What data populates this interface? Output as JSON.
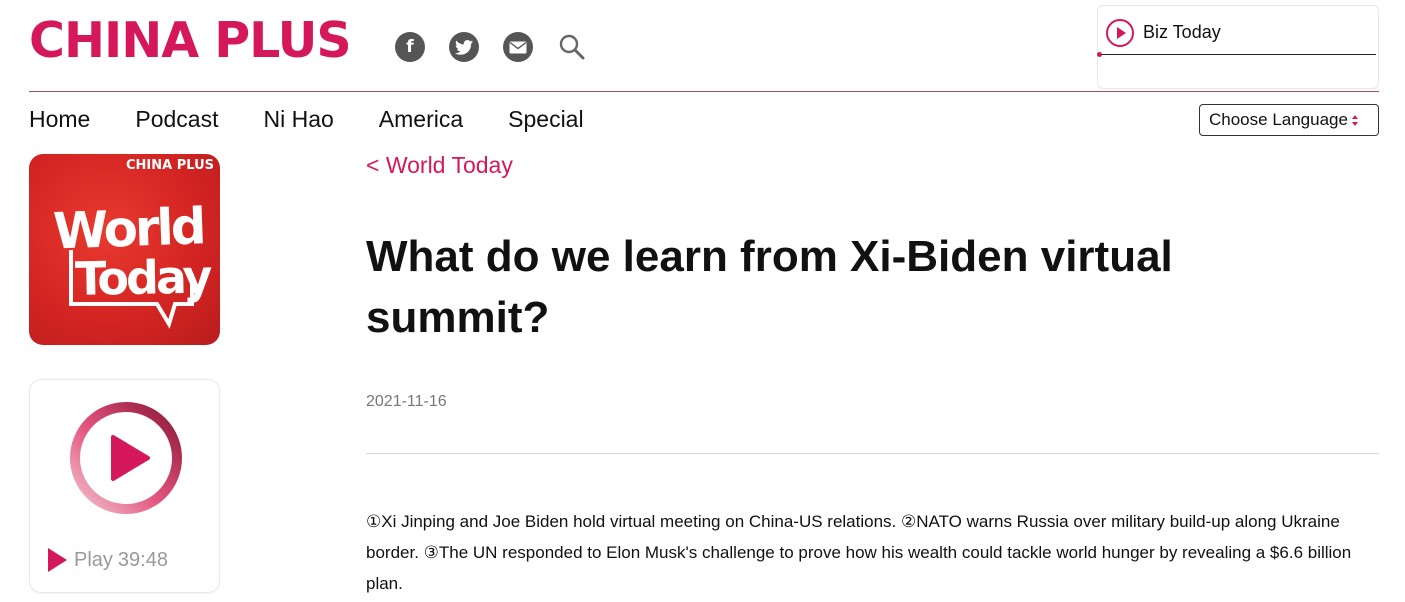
{
  "brand": {
    "logo_text": "CHINA PLUS",
    "accent": "#d4185a"
  },
  "social": [
    {
      "name": "facebook-icon",
      "glyph": "f"
    },
    {
      "name": "twitter-icon"
    },
    {
      "name": "mail-icon"
    },
    {
      "name": "search-icon"
    }
  ],
  "radio": {
    "title": "Biz Today",
    "progress": 0
  },
  "nav": {
    "items": [
      "Home",
      "Podcast",
      "Ni Hao",
      "America",
      "Special"
    ]
  },
  "language": {
    "label": "Choose Language"
  },
  "cover": {
    "brand": "CHINA PLUS",
    "line1": "World",
    "line2": "Today"
  },
  "player": {
    "label": "Play",
    "duration": "39:48"
  },
  "article": {
    "back_link": "< World Today",
    "title": "What do we learn from Xi-Biden virtual summit?",
    "date": "2021-11-16",
    "summary": "①Xi Jinping and Joe Biden hold virtual meeting on China-US relations. ②NATO warns Russia over military build-up along Ukraine border. ③The UN responded to Elon Musk's challenge to prove how his wealth could tackle world hunger by revealing a $6.6 billion plan."
  }
}
